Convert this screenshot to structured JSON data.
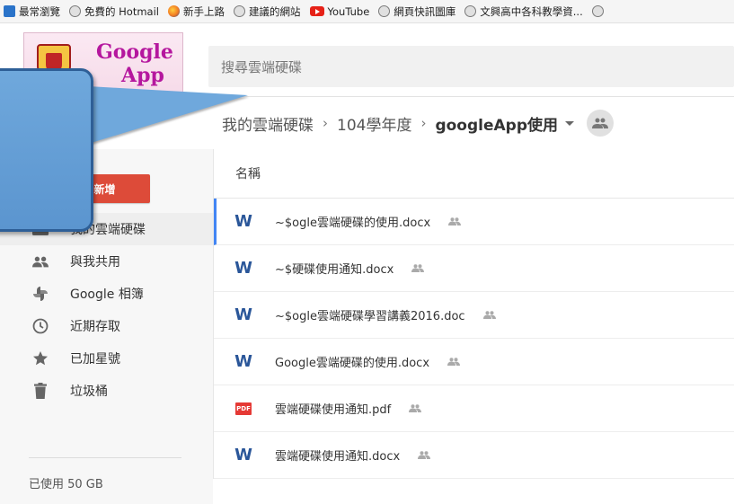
{
  "bookmarks": [
    {
      "label": "最常瀏覽",
      "icon": "ie-icon"
    },
    {
      "label": "免費的 Hotmail",
      "icon": "globe-icon"
    },
    {
      "label": "新手上路",
      "icon": "firefox-icon"
    },
    {
      "label": "建議的網站",
      "icon": "globe-icon"
    },
    {
      "label": "YouTube",
      "icon": "youtube-icon"
    },
    {
      "label": "網頁快訊圖庫",
      "icon": "globe-icon"
    },
    {
      "label": "文興高中各科教學資...",
      "icon": "globe-icon"
    }
  ],
  "logo": {
    "line1": "Google",
    "line2": "App"
  },
  "search": {
    "placeholder": "搜尋雲端硬碟"
  },
  "breadcrumb": {
    "items": [
      "我的雲端硬碟",
      "104學年度"
    ],
    "current": "googleApp使用",
    "separator": "›"
  },
  "sidebar": {
    "new_label": "新增",
    "items": [
      {
        "label": "我的雲端硬碟",
        "icon": "drive-icon"
      },
      {
        "label": "與我共用",
        "icon": "people-icon"
      },
      {
        "label": "Google 相簿",
        "icon": "photos-icon"
      },
      {
        "label": "近期存取",
        "icon": "clock-icon"
      },
      {
        "label": "已加星號",
        "icon": "star-icon"
      },
      {
        "label": "垃圾桶",
        "icon": "trash-icon"
      }
    ],
    "storage": "已使用 50 GB"
  },
  "list": {
    "header": "名稱",
    "files": [
      {
        "name": "~$ogle雲端硬碟的使用.docx",
        "type": "word"
      },
      {
        "name": "~$硬碟使用通知.docx",
        "type": "word"
      },
      {
        "name": "~$ogle雲端硬碟學習講義2016.doc",
        "type": "word"
      },
      {
        "name": "Google雲端硬碟的使用.docx",
        "type": "word"
      },
      {
        "name": "雲端硬碟使用通知.pdf",
        "type": "pdf"
      },
      {
        "name": "雲端硬碟使用通知.docx",
        "type": "word"
      }
    ]
  },
  "colors": {
    "new_button": "#dd4b39",
    "callout": "#6fa8dc",
    "word": "#2a5699",
    "pdf": "#e53935",
    "selection": "#4285f4"
  }
}
